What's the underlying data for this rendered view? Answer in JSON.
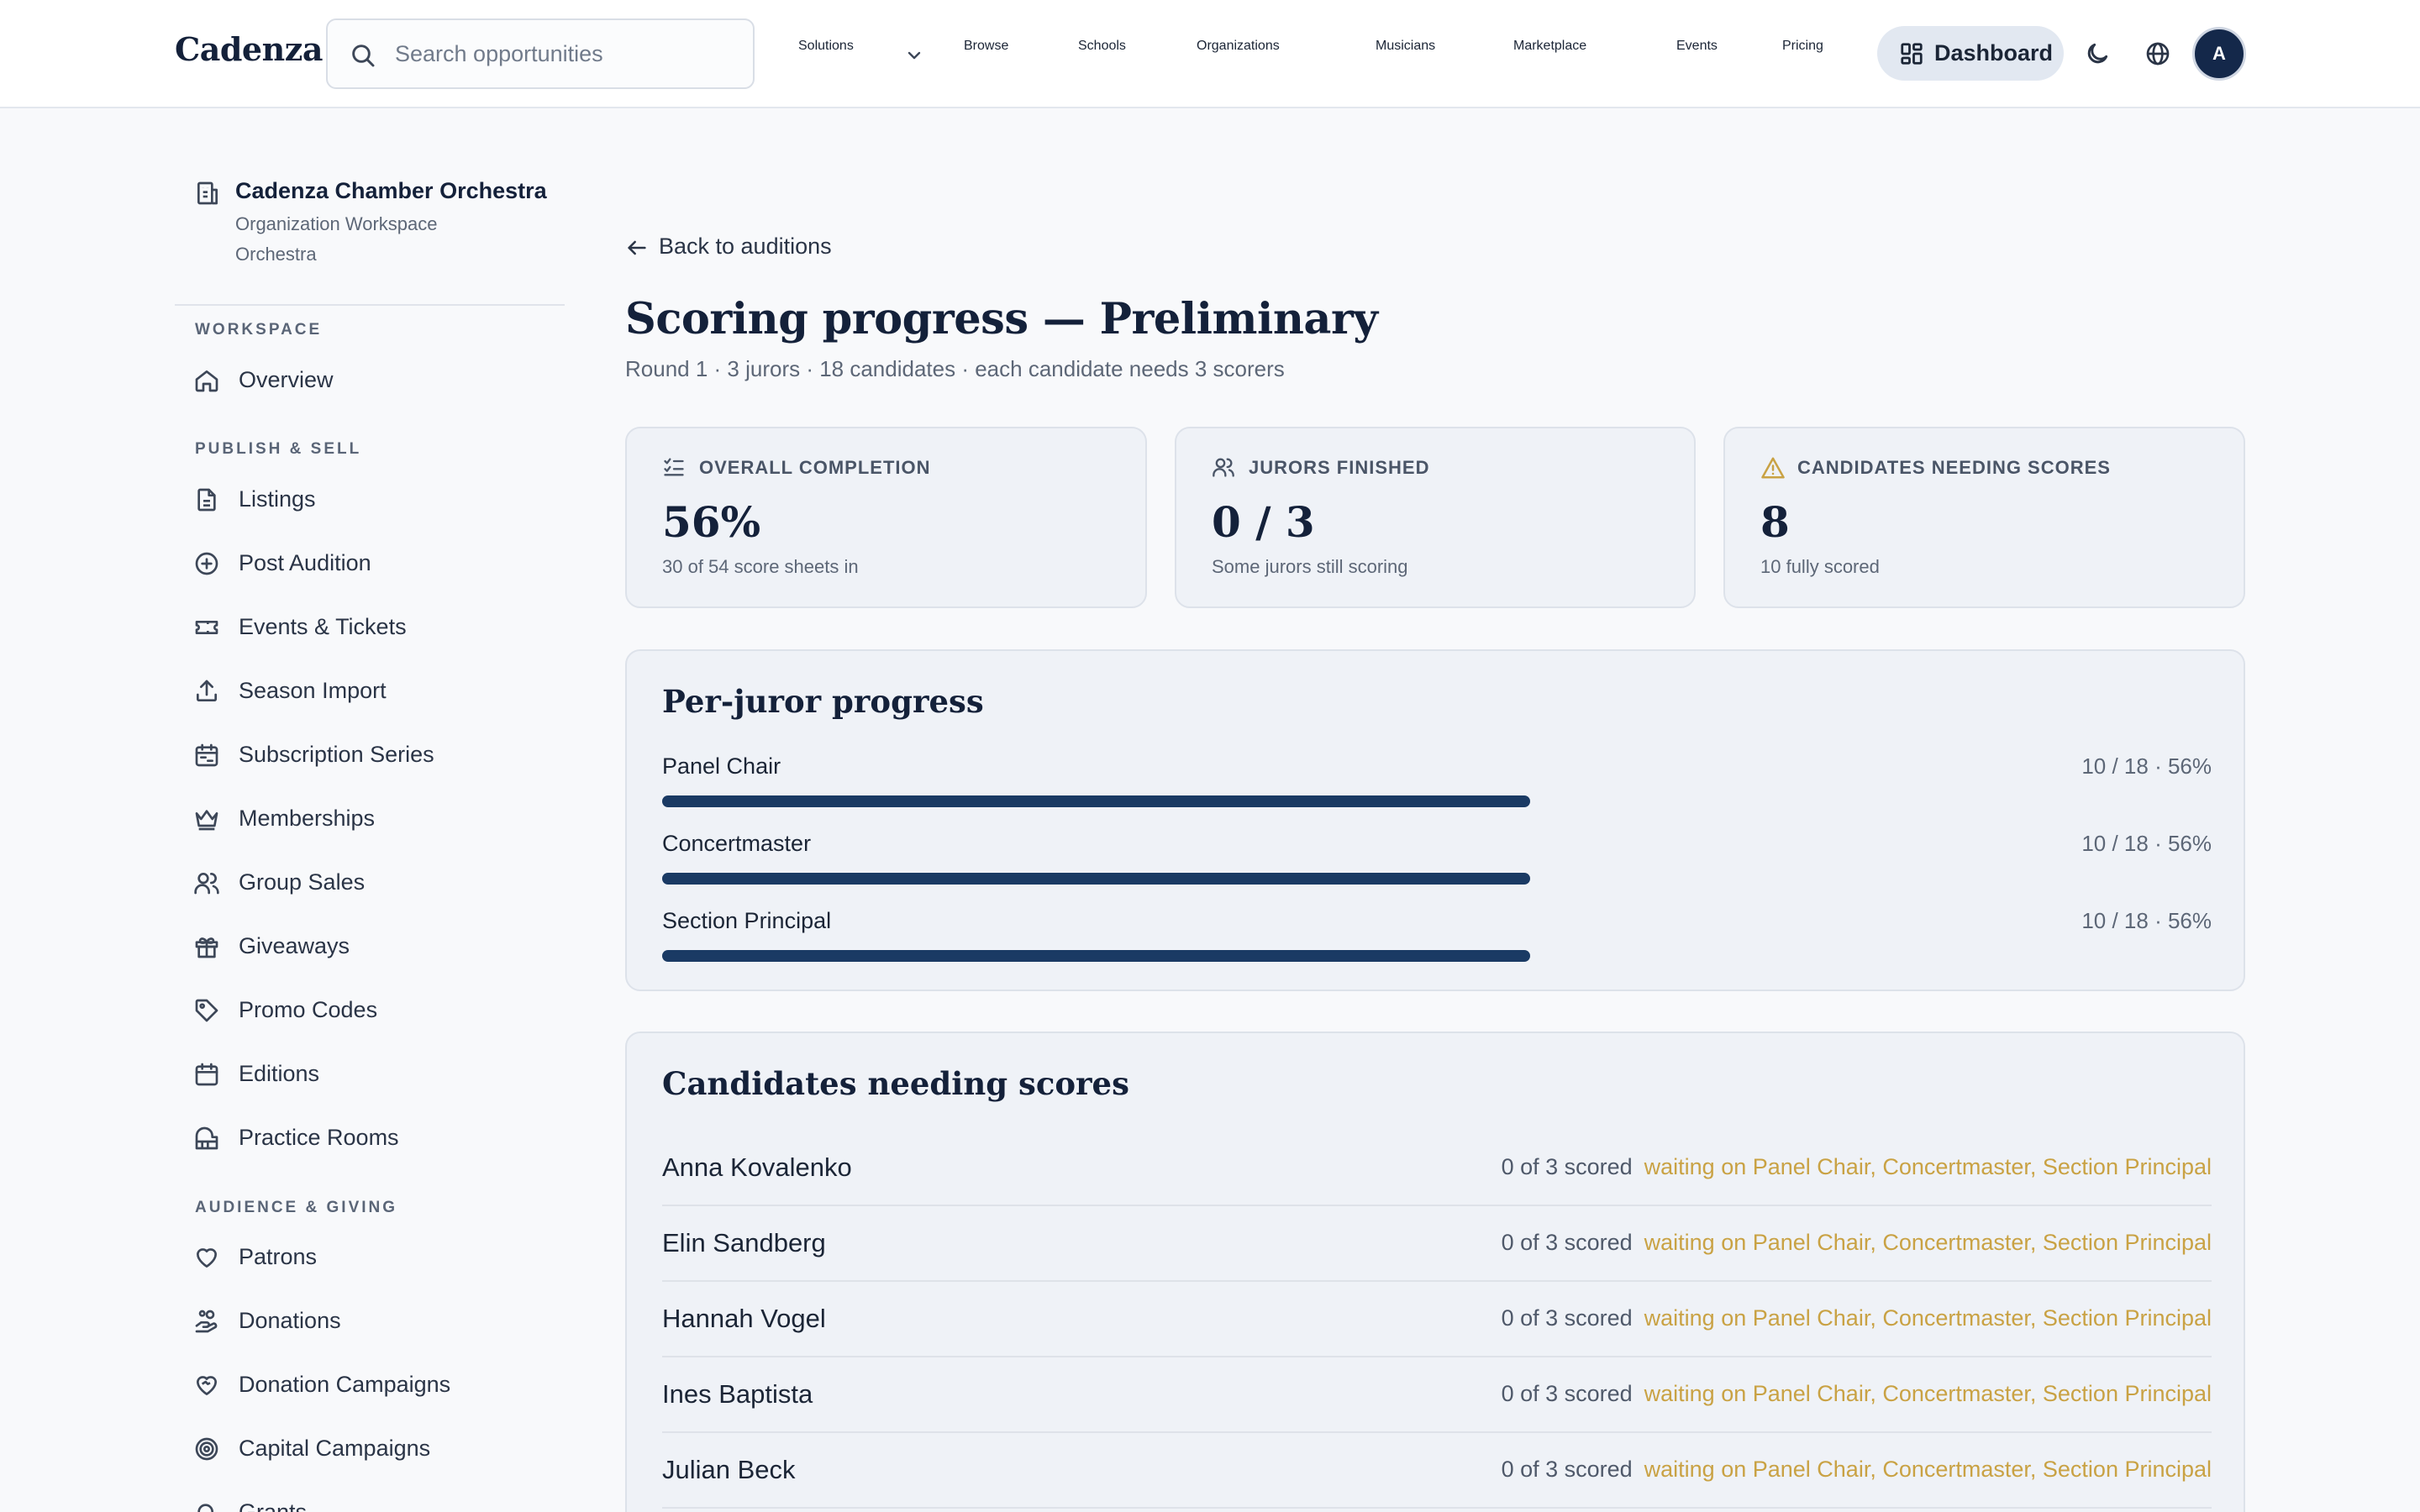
{
  "brand": "Cadenza",
  "search": {
    "placeholder": "Search opportunities"
  },
  "nav": {
    "solutions": "Solutions",
    "browse": "Browse",
    "schools": "Schools",
    "organizations": "Organizations",
    "musicians": "Musicians",
    "marketplace": "Marketplace",
    "events": "Events",
    "pricing": "Pricing",
    "dashboard": "Dashboard",
    "avatar_initial": "A"
  },
  "sidebar": {
    "org_name": "Cadenza Chamber Orchestra",
    "org_subtitle": "Organization Workspace",
    "org_type": "Orchestra",
    "section_workspace": "WORKSPACE",
    "overview": "Overview",
    "section_publish": "PUBLISH & SELL",
    "publish_items": [
      "Listings",
      "Post Audition",
      "Events & Tickets",
      "Season Import",
      "Subscription Series",
      "Memberships",
      "Group Sales",
      "Giveaways",
      "Promo Codes",
      "Editions",
      "Practice Rooms"
    ],
    "section_audience": "AUDIENCE & GIVING",
    "audience_items": [
      "Patrons",
      "Donations",
      "Donation Campaigns",
      "Capital Campaigns",
      "Grants"
    ]
  },
  "main": {
    "back_label": "Back to auditions",
    "title": "Scoring progress — Preliminary",
    "subtitle": "Round 1 · 3 jurors · 18 candidates · each candidate needs 3 scorers",
    "stats": [
      {
        "label": "OVERALL COMPLETION",
        "value": "56%",
        "note": "30 of 54 score sheets in"
      },
      {
        "label": "JURORS FINISHED",
        "value": "0 / 3",
        "note": "Some jurors still scoring"
      },
      {
        "label": "CANDIDATES NEEDING SCORES",
        "value": "8",
        "note": "10 fully scored"
      }
    ],
    "juror_title": "Per-juror progress",
    "jurors": [
      {
        "name": "Panel Chair",
        "stat": "10 / 18 · 56%",
        "progress": 0.56
      },
      {
        "name": "Concertmaster",
        "stat": "10 / 18 · 56%",
        "progress": 0.56
      },
      {
        "name": "Section Principal",
        "stat": "10 / 18 · 56%",
        "progress": 0.56
      }
    ],
    "candidates_title": "Candidates needing scores",
    "candidates": [
      {
        "name": "Anna Kovalenko",
        "count": "0 of 3 scored",
        "waiting": "waiting on Panel Chair, Concertmaster, Section Principal"
      },
      {
        "name": "Elin Sandberg",
        "count": "0 of 3 scored",
        "waiting": "waiting on Panel Chair, Concertmaster, Section Principal"
      },
      {
        "name": "Hannah Vogel",
        "count": "0 of 3 scored",
        "waiting": "waiting on Panel Chair, Concertmaster, Section Principal"
      },
      {
        "name": "Ines Baptista",
        "count": "0 of 3 scored",
        "waiting": "waiting on Panel Chair, Concertmaster, Section Principal"
      },
      {
        "name": "Julian Beck",
        "count": "0 of 3 scored",
        "waiting": "waiting on Panel Chair, Concertmaster, Section Principal"
      }
    ]
  }
}
